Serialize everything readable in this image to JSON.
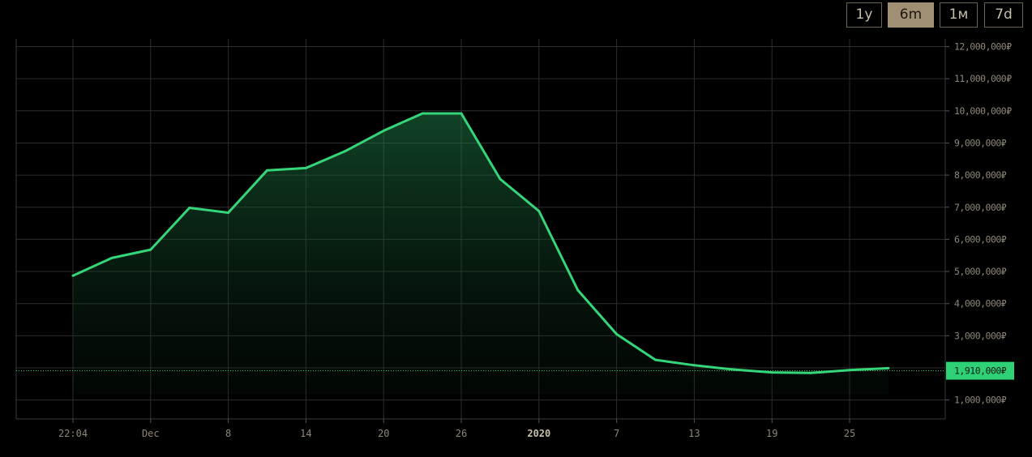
{
  "range_buttons": [
    {
      "label": "1y",
      "active": false
    },
    {
      "label": "6m",
      "active": true
    },
    {
      "label": "1м",
      "active": false
    },
    {
      "label": "7d",
      "active": false
    }
  ],
  "colors": {
    "line": "#35d67a",
    "grid": "#2d2d2d",
    "axis_text": "#8f8779",
    "label_bg": "#2fd177",
    "label_text": "#0b1a10"
  },
  "chart_data": {
    "type": "area",
    "x_ticks": [
      {
        "label": "22:04",
        "bold": false
      },
      {
        "label": "Dec",
        "bold": false
      },
      {
        "label": "8",
        "bold": false
      },
      {
        "label": "14",
        "bold": false
      },
      {
        "label": "20",
        "bold": false
      },
      {
        "label": "26",
        "bold": false
      },
      {
        "label": "2020",
        "bold": true
      },
      {
        "label": "7",
        "bold": false
      },
      {
        "label": "13",
        "bold": false
      },
      {
        "label": "19",
        "bold": false
      },
      {
        "label": "25",
        "bold": false
      }
    ],
    "y_ticks": [
      {
        "value": 1000000,
        "label": "1,000,000₽"
      },
      {
        "value": 3000000,
        "label": "3,000,000₽"
      },
      {
        "value": 4000000,
        "label": "4,000,000₽"
      },
      {
        "value": 5000000,
        "label": "5,000,000₽"
      },
      {
        "value": 6000000,
        "label": "6,000,000₽"
      },
      {
        "value": 7000000,
        "label": "7,000,000₽"
      },
      {
        "value": 8000000,
        "label": "8,000,000₽"
      },
      {
        "value": 9000000,
        "label": "9,000,000₽"
      },
      {
        "value": 10000000,
        "label": "10,000,000₽"
      },
      {
        "value": 11000000,
        "label": "11,000,000₽"
      },
      {
        "value": 12000000,
        "label": "12,000,000₽"
      }
    ],
    "y_range": [
      0,
      12000000
    ],
    "x_range": [
      0,
      11.7
    ],
    "series": [
      {
        "x": [
          0,
          0.5,
          1,
          1.5,
          2,
          2.5,
          3,
          3.5,
          4,
          4.5,
          5,
          5.5,
          6,
          6.5,
          7,
          7.5,
          8,
          8.5,
          9,
          9.5,
          10,
          10.5
        ],
        "y": [
          4870000,
          5420000,
          5680000,
          6980000,
          6830000,
          8150000,
          8220000,
          8740000,
          9380000,
          9920000,
          9920000,
          7880000,
          6880000,
          4420000,
          3050000,
          2250000,
          2080000,
          1950000,
          1860000,
          1840000,
          1930000,
          1990000
        ]
      }
    ],
    "current_value": 1910000,
    "current_label": "1,910,000₽",
    "grid": true
  }
}
